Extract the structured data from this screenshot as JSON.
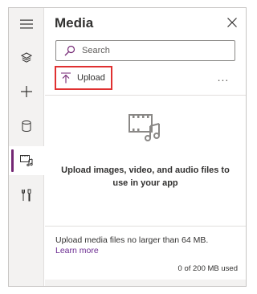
{
  "panel": {
    "title": "Media"
  },
  "search": {
    "placeholder": "Search"
  },
  "toolbar": {
    "upload_label": "Upload",
    "more_label": "..."
  },
  "empty_state": {
    "message": "Upload images, video, and audio files to use in your app"
  },
  "footer": {
    "limit_note": "Upload media files no larger than 64 MB.",
    "learn_more": "Learn more",
    "usage": "0 of 200 MB used"
  },
  "rail": {
    "items": [
      {
        "icon": "hamburger-menu-icon"
      },
      {
        "icon": "layers-icon"
      },
      {
        "icon": "plus-icon"
      },
      {
        "icon": "database-icon"
      },
      {
        "icon": "media-icon",
        "active": true
      },
      {
        "icon": "tools-icon"
      }
    ]
  },
  "colors": {
    "accent": "#742774",
    "highlight": "#e03131",
    "link": "#6b2c91"
  }
}
